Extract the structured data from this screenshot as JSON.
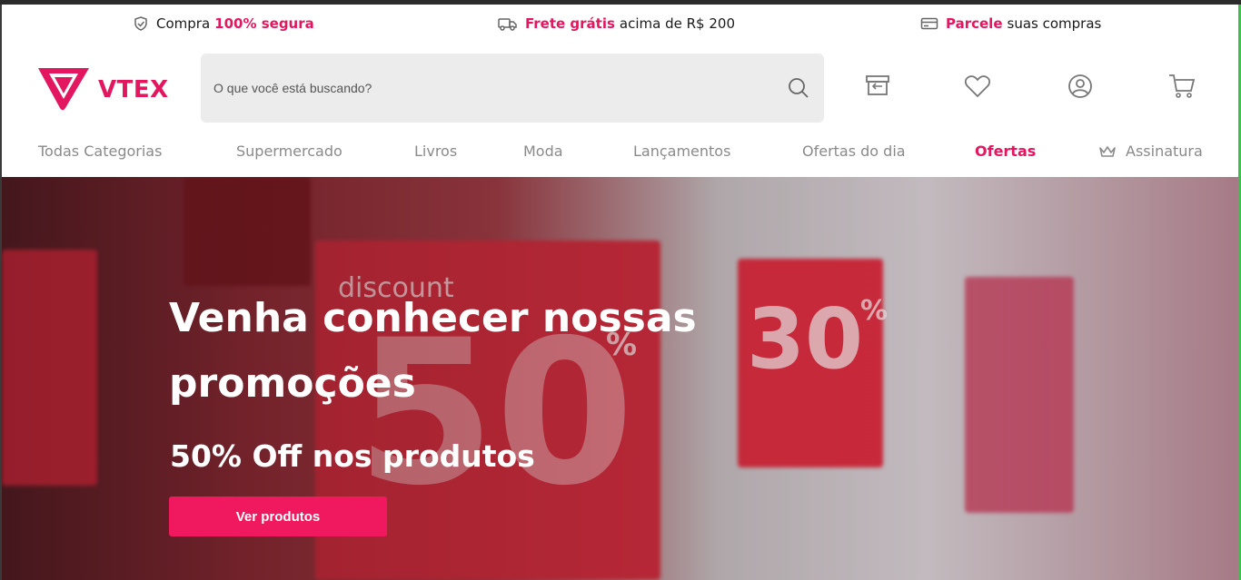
{
  "promo_bar": {
    "items": [
      {
        "icon": "shield-check-icon",
        "prefix": "Compra",
        "highlight": "100% segura",
        "suffix": ""
      },
      {
        "icon": "truck-icon",
        "prefix": "",
        "highlight": "Frete grátis",
        "suffix": "acima de R$ 200"
      },
      {
        "icon": "credit-card-icon",
        "prefix": "",
        "highlight": "Parcele",
        "suffix": "suas compras"
      }
    ]
  },
  "header": {
    "logo_text": "VTEX",
    "search_placeholder": "O que você está buscando?",
    "icons": [
      "gift-box-icon",
      "heart-icon",
      "user-icon",
      "cart-icon"
    ]
  },
  "nav": {
    "items": [
      {
        "label": "Todas Categorias"
      },
      {
        "label": "Supermercado"
      },
      {
        "label": "Livros"
      },
      {
        "label": "Moda"
      },
      {
        "label": "Lançamentos"
      },
      {
        "label": "Ofertas do dia"
      },
      {
        "label": "Ofertas",
        "active": true
      },
      {
        "label": "Assinatura",
        "icon": "crown-icon"
      }
    ]
  },
  "hero": {
    "title": "Venha conhecer nossas promoções",
    "subtitle": "50% Off nos produtos",
    "button_label": "Ver produtos",
    "background_signs": [
      "discount",
      "50",
      "%",
      "30",
      "%"
    ]
  },
  "colors": {
    "accent": "#e2175f",
    "button": "#f0195f",
    "search_bg": "#ececec",
    "nav_text": "#8a8a8a"
  }
}
